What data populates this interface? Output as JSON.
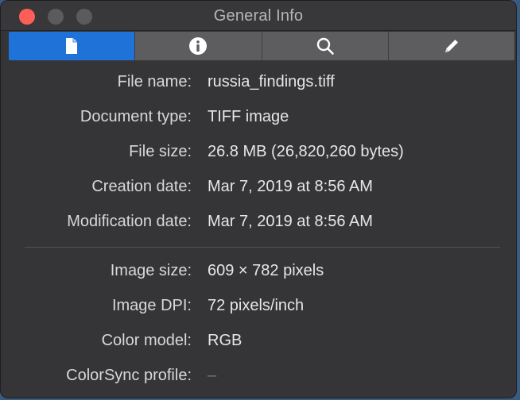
{
  "window": {
    "title": "General Info"
  },
  "tabs": [
    {
      "icon": "document-icon",
      "active": true
    },
    {
      "icon": "info-icon",
      "active": false
    },
    {
      "icon": "magnifier-icon",
      "active": false
    },
    {
      "icon": "pencil-icon",
      "active": false
    }
  ],
  "general": [
    {
      "label": "File name:",
      "value": "russia_findings.tiff"
    },
    {
      "label": "Document type:",
      "value": "TIFF image"
    },
    {
      "label": "File size:",
      "value": "26.8 MB (26,820,260 bytes)"
    },
    {
      "label": "Creation date:",
      "value": "Mar 7, 2019 at 8:56 AM"
    },
    {
      "label": "Modification date:",
      "value": "Mar 7, 2019 at 8:56 AM"
    }
  ],
  "image": [
    {
      "label": "Image size:",
      "value": "609 × 782 pixels"
    },
    {
      "label": "Image DPI:",
      "value": "72 pixels/inch"
    },
    {
      "label": "Color model:",
      "value": "RGB"
    },
    {
      "label": "ColorSync profile:",
      "value": "–"
    }
  ],
  "colors": {
    "accent": "#1f72d8",
    "close": "#fd5f58"
  }
}
